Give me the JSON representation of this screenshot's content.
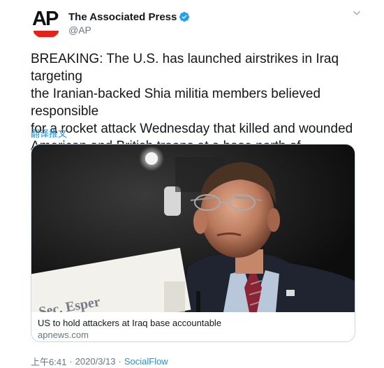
{
  "account": {
    "logo_text": "AP",
    "display_name": "The Associated Press",
    "handle": "@AP",
    "verified": true
  },
  "tweet": {
    "text": "BREAKING: The U.S. has launched airstrikes in Iraq targeting\nthe Iranian-backed Shia militia members believed responsible\nfor a rocket attack Wednesday that killed and wounded\nAmerican and British troops at a base north of Baghdad.",
    "translate_label": "翻译推文"
  },
  "card": {
    "placard_text": "Sec. Esper",
    "title": "US to hold attackers at Iraq base accountable",
    "domain": "apnews.com"
  },
  "meta": {
    "time": "上午6:41",
    "date": "2020/3/13",
    "separator": "·",
    "source": "SocialFlow"
  },
  "colors": {
    "link": "#1b95e0",
    "verified_badge": "#1da1f2",
    "ap_red": "#e32219",
    "secondary_text": "#657786"
  }
}
